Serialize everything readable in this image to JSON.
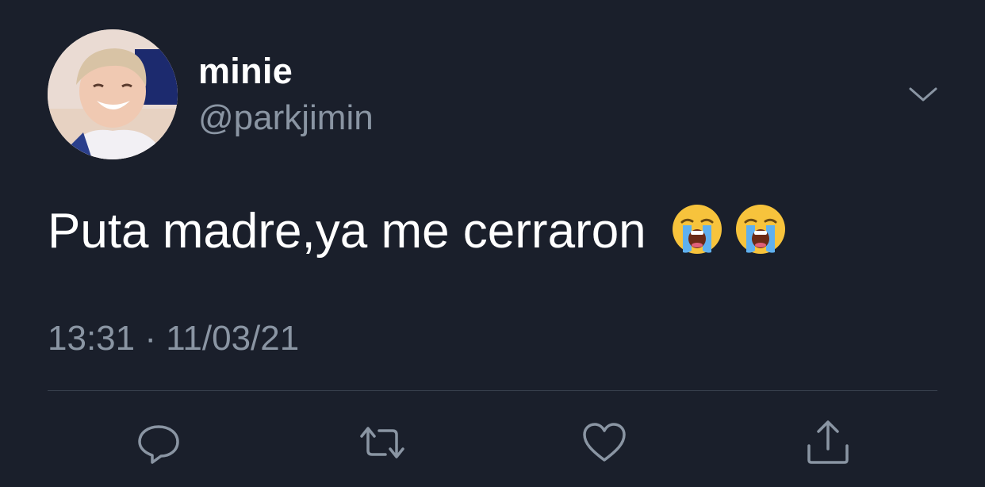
{
  "user": {
    "display_name": "minie",
    "handle": "@parkjimin",
    "avatar": "profile-photo"
  },
  "tweet": {
    "text": "Puta madre,ya me cerraron",
    "emojis": [
      "loudly-crying-face",
      "loudly-crying-face"
    ],
    "timestamp": "13:31 · 11/03/21"
  },
  "icons": {
    "more": "chevron-down-icon",
    "reply": "reply-icon",
    "retweet": "retweet-icon",
    "like": "heart-icon",
    "share": "share-icon"
  },
  "colors": {
    "background": "#1a1f2b",
    "text": "#ffffff",
    "secondary_text": "#8a95a3",
    "divider": "#38404d"
  }
}
